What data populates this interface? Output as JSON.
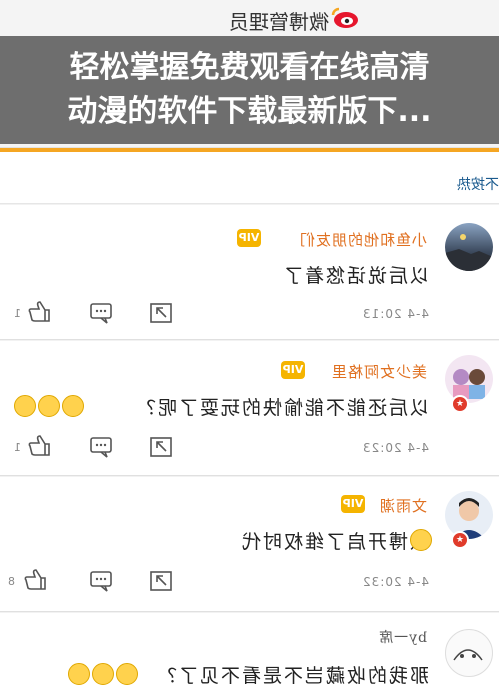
{
  "header": {
    "title": "微博管理员",
    "logo_icon": "weibo-logo-icon"
  },
  "subnav": {
    "label": "不按热"
  },
  "comments": [
    {
      "username": "小鱼和他的朋友们",
      "text": "以后说话悠着了",
      "time": "4-4 20:13",
      "like_count": "1"
    },
    {
      "username": "美少女阿格里",
      "text": "以后还能不能愉快的玩耍了呢？",
      "time": "4-4 20:23",
      "like_count": "1"
    },
    {
      "username": "文雨潮",
      "text": "微博开启了维权时代",
      "time": "4-4 20:32",
      "like_count": "8"
    },
    {
      "username": "by一席",
      "text": "那我的收藏岂不是看不见了？",
      "time": "",
      "like_count": ""
    }
  ],
  "caption": {
    "line1": "轻松掌握免费观看在线高清",
    "line2": "动漫的软件下载最新版下..."
  },
  "colors": {
    "accent": "#f5a623",
    "username": "#e07020",
    "vip": "#f5b400",
    "link": "#1a5a8e"
  }
}
